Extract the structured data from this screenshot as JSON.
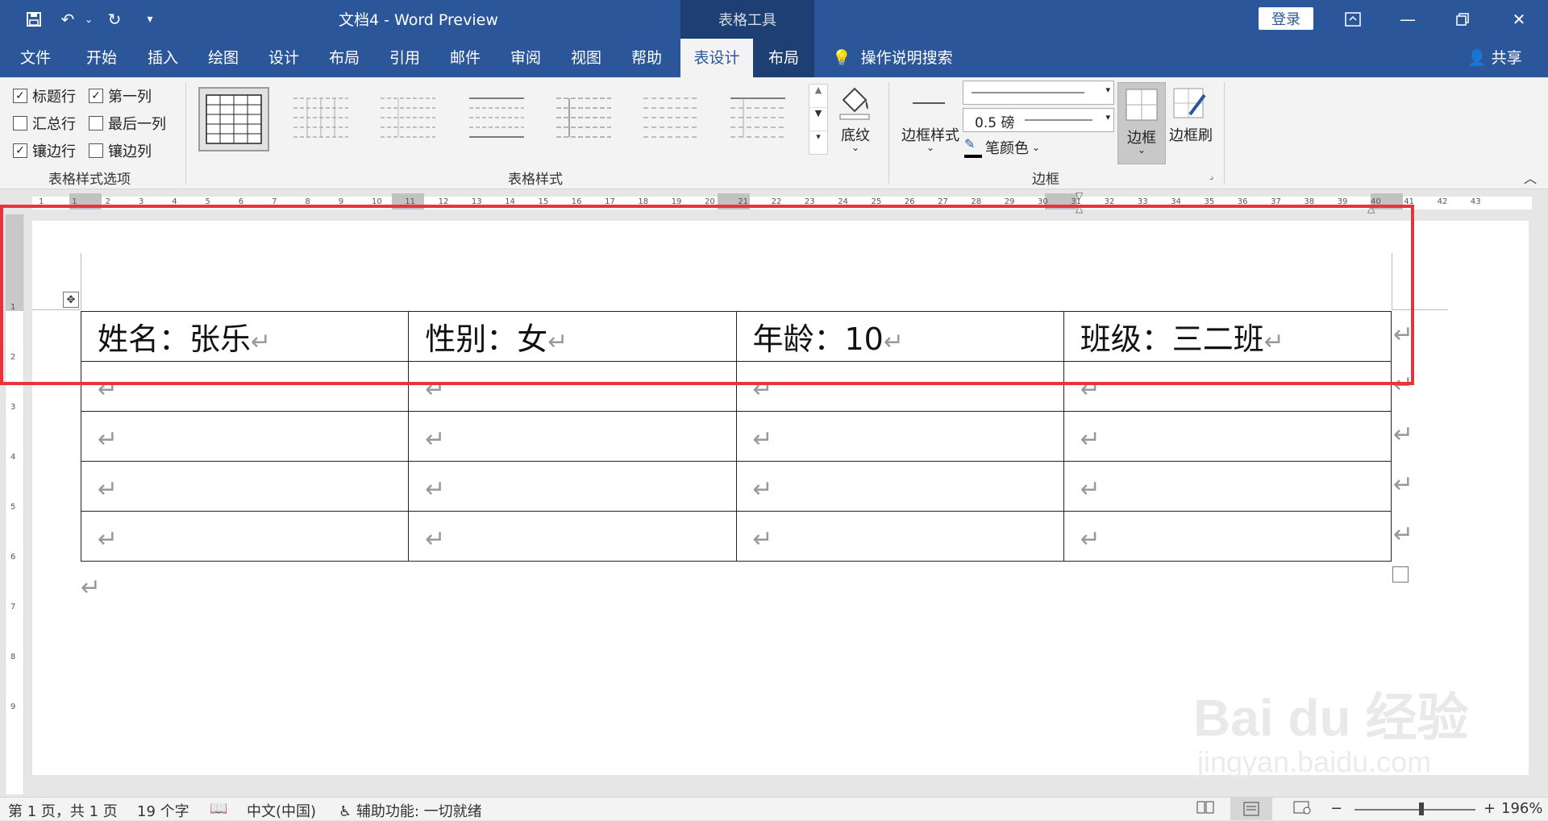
{
  "titlebar": {
    "doc_title": "文档4  -  Word Preview",
    "tools_label": "表格工具",
    "login_label": "登录"
  },
  "menu": {
    "tabs": [
      {
        "label": "文件"
      },
      {
        "label": "开始"
      },
      {
        "label": "插入"
      },
      {
        "label": "绘图"
      },
      {
        "label": "设计"
      },
      {
        "label": "布局"
      },
      {
        "label": "引用"
      },
      {
        "label": "邮件"
      },
      {
        "label": "审阅"
      },
      {
        "label": "视图"
      },
      {
        "label": "帮助"
      },
      {
        "label": "表设计"
      },
      {
        "label": "布局"
      }
    ],
    "tellme": "操作说明搜索",
    "share": "共享"
  },
  "ribbon": {
    "style_options": {
      "items": [
        {
          "label": "标题行",
          "checked": true
        },
        {
          "label": "第一列",
          "checked": true
        },
        {
          "label": "汇总行",
          "checked": false
        },
        {
          "label": "最后一列",
          "checked": false
        },
        {
          "label": "镶边行",
          "checked": true
        },
        {
          "label": "镶边列",
          "checked": false
        }
      ],
      "group_label": "表格样式选项"
    },
    "table_styles": {
      "group_label": "表格样式"
    },
    "shading_label": "底纹",
    "border_styles_label": "边框样式",
    "pen_weight": "0.5 磅",
    "pen_color_label": "笔颜色",
    "borders_label": "边框",
    "border_painter_label": "边框刷",
    "borders_group_label": "边框"
  },
  "ruler": {
    "numbers": [
      "1",
      "1",
      "2",
      "3",
      "4",
      "5",
      "6",
      "7",
      "8",
      "9",
      "10",
      "11",
      "12",
      "13",
      "14",
      "15",
      "16",
      "17",
      "18",
      "19",
      "20",
      "21",
      "22",
      "23",
      "24",
      "25",
      "26",
      "27",
      "28",
      "29",
      "30",
      "31",
      "32",
      "33",
      "34",
      "35",
      "36",
      "37",
      "38",
      "39",
      "40",
      "41",
      "42",
      "43"
    ]
  },
  "vruler": {
    "numbers": [
      "1",
      "2",
      "3",
      "4",
      "5",
      "6",
      "7",
      "8",
      "9"
    ]
  },
  "table": {
    "rows": [
      [
        "姓名：张乐",
        "性别：女",
        "年龄：10",
        "班级：三二班"
      ],
      [
        "",
        "",
        "",
        ""
      ],
      [
        "",
        "",
        "",
        ""
      ],
      [
        "",
        "",
        "",
        ""
      ],
      [
        "",
        "",
        "",
        ""
      ]
    ]
  },
  "statusbar": {
    "page": "第 1 页，共 1 页",
    "words": "19 个字",
    "language": "中文(中国)",
    "accessibility": "辅助功能: 一切就绪",
    "zoom": "196%"
  },
  "watermark": {
    "main": "Bai du 经验",
    "sub": "jingyan.baidu.com"
  },
  "colors": {
    "accent": "#2b579a",
    "highlight": "#e8323c"
  }
}
